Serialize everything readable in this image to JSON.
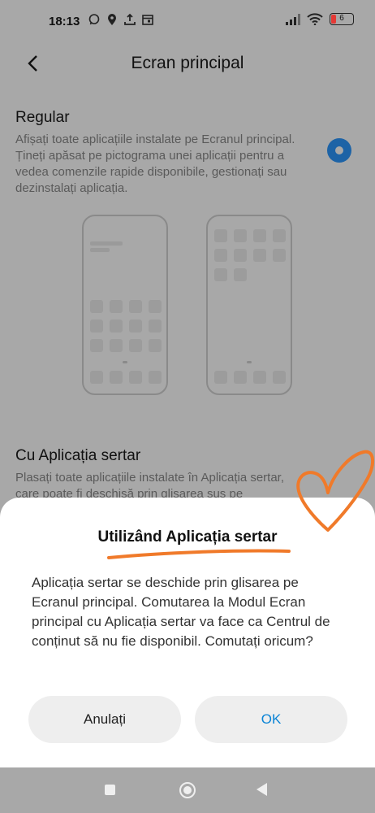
{
  "status_bar": {
    "time": "18:13",
    "battery": "6"
  },
  "header": {
    "title": "Ecran principal"
  },
  "option_regular": {
    "title": "Regular",
    "description": "Afișați toate aplicațiile instalate pe Ecranul principal. Țineți apăsat pe pictograma unei aplicații pentru a vedea comenzile rapide disponibile, gestionați sau dezinstalați aplicația.",
    "selected": true
  },
  "option_drawer": {
    "title": "Cu Aplicația sertar",
    "description": "Plasați toate aplicațiile instalate în Aplicația sertar, care poate fi deschisă prin glisarea sus pe"
  },
  "dialog": {
    "title": "Utilizând Aplicația sertar",
    "message": "Aplicația sertar se deschide prin glisarea pe Ecranul principal. Comutarea la Modul Ecran principal cu Aplicația sertar va face ca Centrul de conținut să nu fie disponibil. Comutați oricum?",
    "cancel_label": "Anulați",
    "ok_label": "OK"
  },
  "colors": {
    "accent": "#0a84d6",
    "radio": "#1d63a6",
    "scribble": "#f07a2a"
  },
  "icons": [
    "back-icon",
    "whatsapp-icon",
    "location-icon",
    "upload-icon",
    "calendar-icon",
    "signal-icon",
    "wifi-icon",
    "battery-icon",
    "nav-recents-icon",
    "nav-home-icon",
    "nav-back-icon"
  ]
}
